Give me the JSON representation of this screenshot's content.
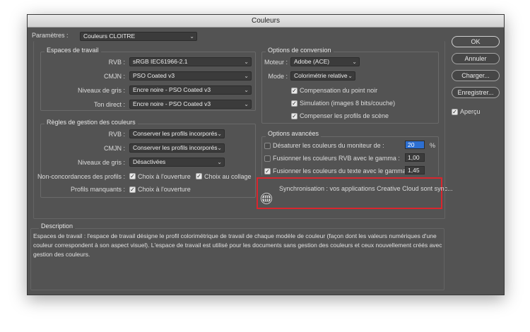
{
  "window": {
    "title": "Couleurs"
  },
  "params": {
    "label": "Paramètres :",
    "value": "Couleurs CLOITRE"
  },
  "workspaces": {
    "title": "Espaces de travail",
    "rows": [
      {
        "label": "RVB :",
        "value": "sRGB IEC61966-2.1"
      },
      {
        "label": "CMJN :",
        "value": "PSO Coated v3"
      },
      {
        "label": "Niveaux de gris :",
        "value": "Encre noire - PSO Coated v3"
      },
      {
        "label": "Ton direct :",
        "value": "Encre noire - PSO Coated v3"
      }
    ]
  },
  "policies": {
    "title": "Règles de gestion des couleurs",
    "rows": [
      {
        "label": "RVB :",
        "value": "Conserver les profils incorporés"
      },
      {
        "label": "CMJN :",
        "value": "Conserver les profils incorporés"
      },
      {
        "label": "Niveaux de gris :",
        "value": "Désactivées"
      }
    ],
    "mismatch_label": "Non-concordances des profils :",
    "mismatch_open": "Choix à l'ouverture",
    "mismatch_paste": "Choix au collage",
    "missing_label": "Profils manquants :",
    "missing_open": "Choix à l'ouverture"
  },
  "conversion": {
    "title": "Options de conversion",
    "engine_label": "Moteur :",
    "engine_value": "Adobe (ACE)",
    "mode_label": "Mode :",
    "mode_value": "Colorimétrie relative",
    "checks": [
      {
        "label": "Compensation du point noir",
        "checked": true
      },
      {
        "label": "Simulation (images 8 bits/couche)",
        "checked": true
      },
      {
        "label": "Compenser les profils de scène",
        "checked": true
      }
    ]
  },
  "advanced": {
    "title": "Options avancées",
    "rows": [
      {
        "label": "Désaturer les couleurs du moniteur de :",
        "value": "20",
        "unit": "%",
        "checked": false
      },
      {
        "label": "Fusionner les couleurs RVB avec le gamma :",
        "value": "1,00",
        "checked": false
      },
      {
        "label": "Fusionner les couleurs du texte avec le gamma :",
        "value": "1,45",
        "checked": true
      }
    ]
  },
  "sync": {
    "text": "Synchronisation : vos applications Creative Cloud sont sync..."
  },
  "description": {
    "title": "Description",
    "text": "Espaces de travail : l'espace de travail désigne le profil colorimétrique de travail de chaque modèle de couleur (façon dont les valeurs numériques d'une couleur correspondent à son aspect visuel). L'espace de travail est utilisé pour les documents sans gestion des couleurs et ceux nouvellement créés avec gestion des couleurs."
  },
  "buttons": {
    "ok": "OK",
    "cancel": "Annuler",
    "load": "Charger...",
    "save": "Enregistrer..."
  },
  "preview": {
    "label": "Aperçu",
    "checked": true
  },
  "icons": {
    "check": "checkmark-icon",
    "chevron": "chevron-updown-icon",
    "globe": "globe-icon"
  },
  "colors": {
    "window_bg": "#535353",
    "highlight_border": "#d9262e",
    "selected_field": "#2d6fd1"
  }
}
